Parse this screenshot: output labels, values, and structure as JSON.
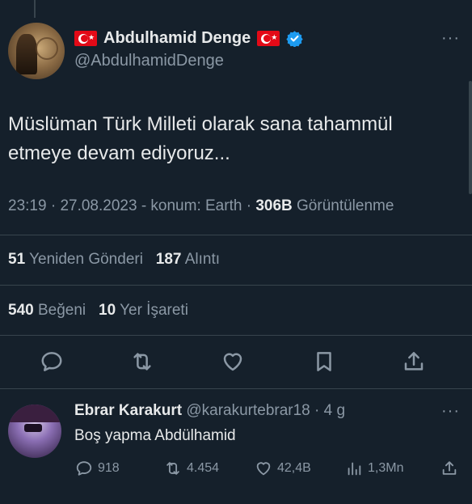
{
  "tweet": {
    "author_name": "Abdulhamid Denge",
    "handle": "@AbdulhamidDenge",
    "text_line1": "Müslüman Türk Milleti olarak sana tahammül",
    "text_line2": "etmeye devam ediyoruz...",
    "time": "23:19",
    "date": "27.08.2023",
    "location": "konum: Earth",
    "views_count": "306B",
    "views_label": "Görüntülenme",
    "reposts_count": "51",
    "reposts_label": "Yeniden Gönderi",
    "quotes_count": "187",
    "quotes_label": "Alıntı",
    "likes_count": "540",
    "likes_label": "Beğeni",
    "bookmarks_count": "10",
    "bookmarks_label": "Yer İşareti",
    "more": "···"
  },
  "reply": {
    "author_name": "Ebrar Karakurt",
    "handle": "@karakurtebrar18",
    "age": "4 g",
    "text": "Boş yapma Abdülhamid",
    "replies": "918",
    "reposts": "4.454",
    "likes": "42,4B",
    "views": "1,3Mn",
    "more": "···"
  },
  "icons": {
    "verified": "verified-badge-icon",
    "flag": "turkish-flag-icon",
    "reply": "reply-icon",
    "repost": "repost-icon",
    "like": "heart-icon",
    "bookmark": "bookmark-icon",
    "share": "share-icon",
    "views": "views-icon"
  },
  "colors": {
    "background": "#15202b",
    "text": "#e7e9ea",
    "muted": "#8b98a5",
    "accent": "#1d9bf0",
    "flag": "#e30a17"
  }
}
